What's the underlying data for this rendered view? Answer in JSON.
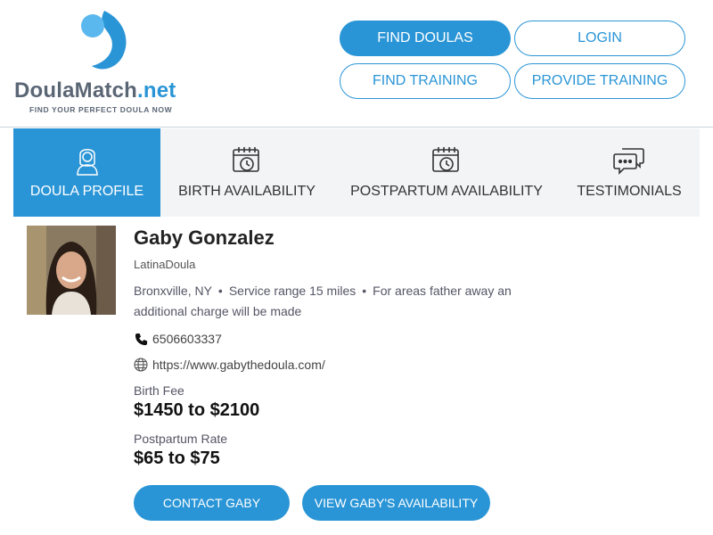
{
  "brand": {
    "name_part1": "Doula",
    "name_part2": "Match",
    "name_part3": ".net",
    "tagline": "FIND YOUR PERFECT DOULA NOW",
    "logo_icon": "doula-drop-logo-icon"
  },
  "nav": {
    "find_doulas": "FIND DOULAS",
    "login": "LOGIN",
    "find_training": "FIND TRAINING",
    "provide_training": "PROVIDE TRAINING"
  },
  "tabs": [
    {
      "label": "DOULA PROFILE",
      "icon": "person-icon",
      "active": true
    },
    {
      "label": "BIRTH AVAILABILITY",
      "icon": "calendar-clock-icon",
      "active": false
    },
    {
      "label": "POSTPARTUM AVAILABILITY",
      "icon": "calendar-clock-icon",
      "active": false
    },
    {
      "label": "TESTIMONIALS",
      "icon": "chat-bubbles-icon",
      "active": false
    }
  ],
  "profile": {
    "name": "Gaby Gonzalez",
    "agency": "LatinaDoula",
    "location": "Bronxville, NY",
    "service_range": "Service range 15 miles",
    "extra_charge_note": "For areas father away an additional charge will be made",
    "phone": "6506603337",
    "website": "https://www.gabythedoula.com/",
    "birth_fee_label": "Birth Fee",
    "birth_fee": "$1450 to $2100",
    "postpartum_label": "Postpartum Rate",
    "postpartum_rate": "$65 to $75"
  },
  "actions": {
    "contact": "CONTACT GABY",
    "availability": "VIEW GABY'S AVAILABILITY"
  },
  "colors": {
    "accent": "#2a95d6",
    "tab_bg": "#f2f4f6",
    "logo_gray": "#5b6675"
  }
}
